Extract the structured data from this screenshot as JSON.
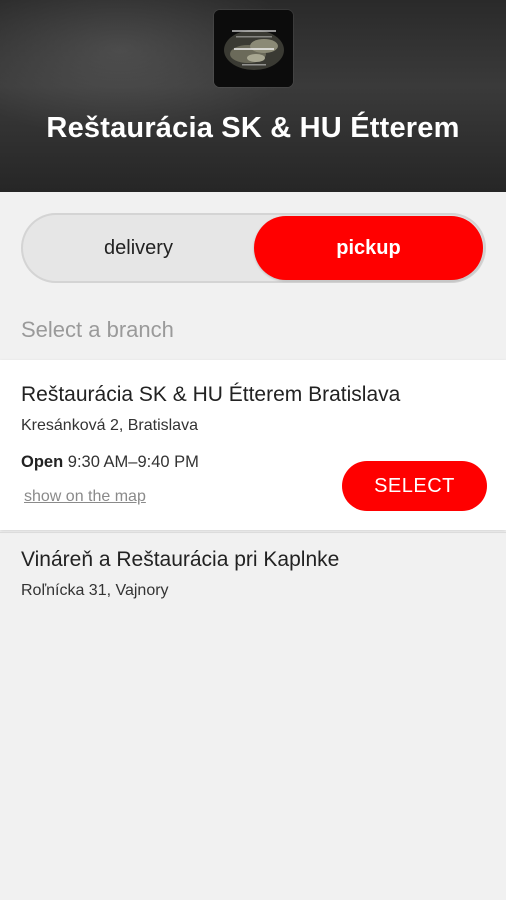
{
  "header": {
    "title": "Reštaurácia SK & HU Étterem"
  },
  "mode_toggle": {
    "options": [
      "delivery",
      "pickup"
    ],
    "selected": "pickup"
  },
  "branches_section": {
    "label": "Select a branch"
  },
  "branches": [
    {
      "name": "Reštaurácia SK & HU Étterem Bratislava",
      "address": "Kresánková 2, Bratislava",
      "status": "Open",
      "hours": "9:30 AM–9:40 PM",
      "map_link": "show on the map",
      "select_label": "SELECT"
    },
    {
      "name": "Vináreň a Reštaurácia pri Kaplnke",
      "address": "Roľnícka 31, Vajnory"
    }
  ],
  "colors": {
    "accent": "#ff0000",
    "header_bg": "#2e2e2e",
    "background": "#f1f1f1"
  }
}
